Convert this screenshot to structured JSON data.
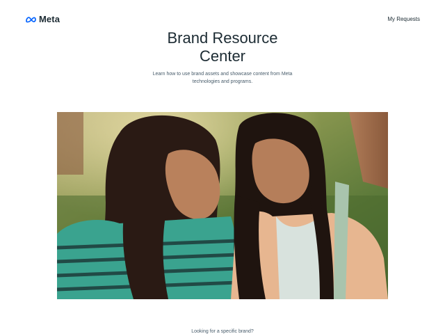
{
  "header": {
    "logo_text": "Meta",
    "logo_icon": "meta-infinity-icon",
    "my_requests_label": "My Requests"
  },
  "hero": {
    "title_line1": "Brand Resource",
    "title_line2": "Center",
    "subtitle_line1": "Learn how to use brand assets and showcase content from Meta",
    "subtitle_line2": "technologies and programs."
  },
  "footer_teaser": {
    "question": "Looking for a specific brand?"
  },
  "colors": {
    "text_primary": "#1c2b33",
    "text_secondary": "#465a69",
    "meta_blue": "#0866ff",
    "background": "#ffffff"
  }
}
